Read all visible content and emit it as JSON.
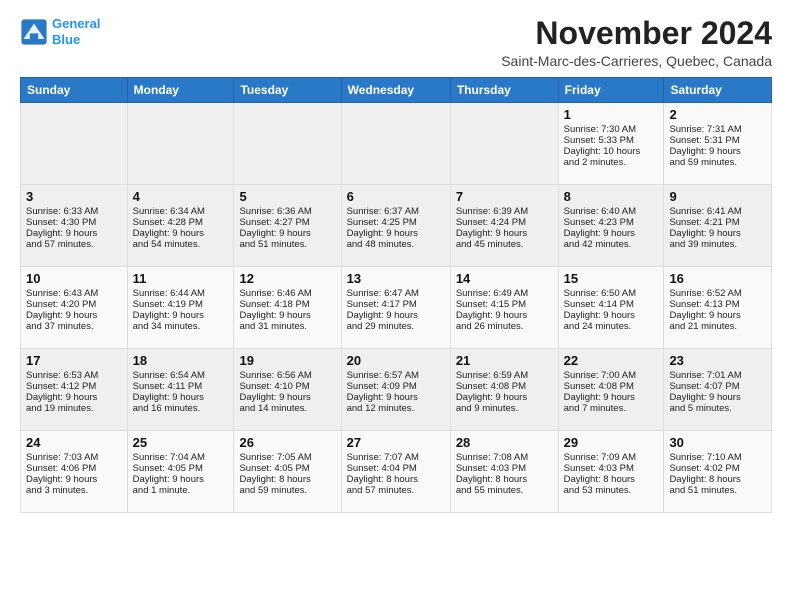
{
  "header": {
    "logo_line1": "General",
    "logo_line2": "Blue",
    "month": "November 2024",
    "location": "Saint-Marc-des-Carrieres, Quebec, Canada"
  },
  "weekdays": [
    "Sunday",
    "Monday",
    "Tuesday",
    "Wednesday",
    "Thursday",
    "Friday",
    "Saturday"
  ],
  "rows": [
    [
      {
        "day": "",
        "info": ""
      },
      {
        "day": "",
        "info": ""
      },
      {
        "day": "",
        "info": ""
      },
      {
        "day": "",
        "info": ""
      },
      {
        "day": "",
        "info": ""
      },
      {
        "day": "1",
        "info": "Sunrise: 7:30 AM\nSunset: 5:33 PM\nDaylight: 10 hours\nand 2 minutes."
      },
      {
        "day": "2",
        "info": "Sunrise: 7:31 AM\nSunset: 5:31 PM\nDaylight: 9 hours\nand 59 minutes."
      }
    ],
    [
      {
        "day": "3",
        "info": "Sunrise: 6:33 AM\nSunset: 4:30 PM\nDaylight: 9 hours\nand 57 minutes."
      },
      {
        "day": "4",
        "info": "Sunrise: 6:34 AM\nSunset: 4:28 PM\nDaylight: 9 hours\nand 54 minutes."
      },
      {
        "day": "5",
        "info": "Sunrise: 6:36 AM\nSunset: 4:27 PM\nDaylight: 9 hours\nand 51 minutes."
      },
      {
        "day": "6",
        "info": "Sunrise: 6:37 AM\nSunset: 4:25 PM\nDaylight: 9 hours\nand 48 minutes."
      },
      {
        "day": "7",
        "info": "Sunrise: 6:39 AM\nSunset: 4:24 PM\nDaylight: 9 hours\nand 45 minutes."
      },
      {
        "day": "8",
        "info": "Sunrise: 6:40 AM\nSunset: 4:23 PM\nDaylight: 9 hours\nand 42 minutes."
      },
      {
        "day": "9",
        "info": "Sunrise: 6:41 AM\nSunset: 4:21 PM\nDaylight: 9 hours\nand 39 minutes."
      }
    ],
    [
      {
        "day": "10",
        "info": "Sunrise: 6:43 AM\nSunset: 4:20 PM\nDaylight: 9 hours\nand 37 minutes."
      },
      {
        "day": "11",
        "info": "Sunrise: 6:44 AM\nSunset: 4:19 PM\nDaylight: 9 hours\nand 34 minutes."
      },
      {
        "day": "12",
        "info": "Sunrise: 6:46 AM\nSunset: 4:18 PM\nDaylight: 9 hours\nand 31 minutes."
      },
      {
        "day": "13",
        "info": "Sunrise: 6:47 AM\nSunset: 4:17 PM\nDaylight: 9 hours\nand 29 minutes."
      },
      {
        "day": "14",
        "info": "Sunrise: 6:49 AM\nSunset: 4:15 PM\nDaylight: 9 hours\nand 26 minutes."
      },
      {
        "day": "15",
        "info": "Sunrise: 6:50 AM\nSunset: 4:14 PM\nDaylight: 9 hours\nand 24 minutes."
      },
      {
        "day": "16",
        "info": "Sunrise: 6:52 AM\nSunset: 4:13 PM\nDaylight: 9 hours\nand 21 minutes."
      }
    ],
    [
      {
        "day": "17",
        "info": "Sunrise: 6:53 AM\nSunset: 4:12 PM\nDaylight: 9 hours\nand 19 minutes."
      },
      {
        "day": "18",
        "info": "Sunrise: 6:54 AM\nSunset: 4:11 PM\nDaylight: 9 hours\nand 16 minutes."
      },
      {
        "day": "19",
        "info": "Sunrise: 6:56 AM\nSunset: 4:10 PM\nDaylight: 9 hours\nand 14 minutes."
      },
      {
        "day": "20",
        "info": "Sunrise: 6:57 AM\nSunset: 4:09 PM\nDaylight: 9 hours\nand 12 minutes."
      },
      {
        "day": "21",
        "info": "Sunrise: 6:59 AM\nSunset: 4:08 PM\nDaylight: 9 hours\nand 9 minutes."
      },
      {
        "day": "22",
        "info": "Sunrise: 7:00 AM\nSunset: 4:08 PM\nDaylight: 9 hours\nand 7 minutes."
      },
      {
        "day": "23",
        "info": "Sunrise: 7:01 AM\nSunset: 4:07 PM\nDaylight: 9 hours\nand 5 minutes."
      }
    ],
    [
      {
        "day": "24",
        "info": "Sunrise: 7:03 AM\nSunset: 4:06 PM\nDaylight: 9 hours\nand 3 minutes."
      },
      {
        "day": "25",
        "info": "Sunrise: 7:04 AM\nSunset: 4:05 PM\nDaylight: 9 hours\nand 1 minute."
      },
      {
        "day": "26",
        "info": "Sunrise: 7:05 AM\nSunset: 4:05 PM\nDaylight: 8 hours\nand 59 minutes."
      },
      {
        "day": "27",
        "info": "Sunrise: 7:07 AM\nSunset: 4:04 PM\nDaylight: 8 hours\nand 57 minutes."
      },
      {
        "day": "28",
        "info": "Sunrise: 7:08 AM\nSunset: 4:03 PM\nDaylight: 8 hours\nand 55 minutes."
      },
      {
        "day": "29",
        "info": "Sunrise: 7:09 AM\nSunset: 4:03 PM\nDaylight: 8 hours\nand 53 minutes."
      },
      {
        "day": "30",
        "info": "Sunrise: 7:10 AM\nSunset: 4:02 PM\nDaylight: 8 hours\nand 51 minutes."
      }
    ]
  ]
}
